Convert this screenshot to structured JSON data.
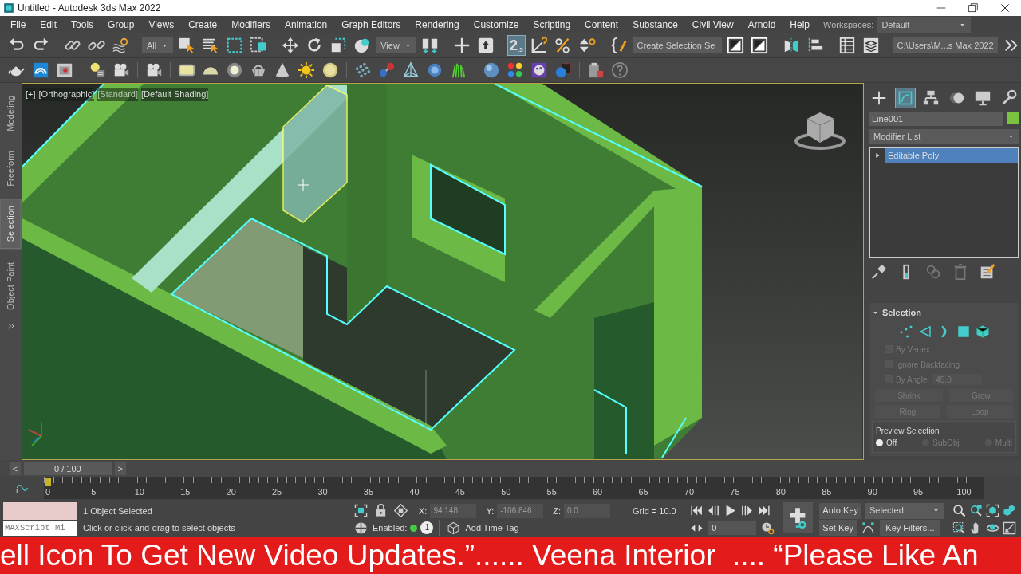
{
  "window": {
    "title": "Untitled - Autodesk 3ds Max 2022"
  },
  "menu": [
    "File",
    "Edit",
    "Tools",
    "Group",
    "Views",
    "Create",
    "Modifiers",
    "Animation",
    "Graph Editors",
    "Rendering",
    "Customize",
    "Scripting",
    "Content",
    "Substance",
    "Civil View",
    "Arnold",
    "Help"
  ],
  "workspaces": {
    "label": "Workspaces:",
    "value": "Default"
  },
  "toolbar": {
    "selection_filter": "All",
    "reference_coordinate": "View",
    "snap_toggle": {
      "label": "2",
      "sub": ".5",
      "selected": true
    },
    "named_selection": "Create Selection Se",
    "project_path": "C:\\Users\\M...s Max 2022"
  },
  "ribbon_tabs": [
    {
      "label": "Modeling",
      "selected": false
    },
    {
      "label": "Freeform",
      "selected": false
    },
    {
      "label": "Selection",
      "selected": true
    },
    {
      "label": "Object Paint",
      "selected": false
    }
  ],
  "viewport": {
    "labels": [
      {
        "text": "[+]",
        "kind": "menu"
      },
      {
        "text": "[Orthographic]",
        "kind": "menu"
      },
      {
        "text": "[Standard]",
        "kind": "dim"
      },
      {
        "text": "[Default Shading]",
        "kind": "menu"
      }
    ]
  },
  "command_panel": {
    "tabs": [
      {
        "selected": false
      },
      {
        "selected": true
      },
      {
        "selected": false
      },
      {
        "selected": false
      },
      {
        "selected": false
      },
      {
        "selected": false
      }
    ],
    "object_name": "Line001",
    "modifier_list": "Modifier List",
    "stack": [
      {
        "label": "Editable Poly",
        "selected": true
      }
    ],
    "selection": {
      "title": "Selection",
      "levels": [
        {
          "selected": false
        },
        {
          "selected": false
        },
        {
          "selected": false
        },
        {
          "selected": false
        },
        {
          "selected": false
        }
      ],
      "checks": [
        {
          "label": "By Vertex",
          "checked": false,
          "disabled": true
        },
        {
          "label": "Ignore Backfacing",
          "checked": false,
          "disabled": true
        }
      ],
      "angle": {
        "label": "By Angle:",
        "value": "45.0",
        "checked": false,
        "disabled": true
      },
      "buttons": [
        {
          "label": "Shrink",
          "disabled": true
        },
        {
          "label": "Grow",
          "disabled": true
        },
        {
          "label": "Ring",
          "disabled": true
        },
        {
          "label": "Loop",
          "disabled": true
        }
      ],
      "preview": {
        "title": "Preview Selection",
        "options": [
          {
            "label": "Off",
            "selected": true,
            "disabled": false
          },
          {
            "label": "SubObj",
            "selected": false,
            "disabled": true
          },
          {
            "label": "Multi",
            "selected": false,
            "disabled": true
          }
        ]
      }
    }
  },
  "timeline": {
    "level": 0,
    "prev": "<",
    "position": "0 / 100",
    "next": ">",
    "ticks": [
      "0",
      "5",
      "10",
      "15",
      "20",
      "25",
      "30",
      "35",
      "40",
      "45",
      "50",
      "55",
      "60",
      "65",
      "70",
      "75",
      "80",
      "85",
      "90",
      "95",
      "100"
    ]
  },
  "status": {
    "selected": "1 Object Selected",
    "prompt": "Click or click-and-drag to select objects",
    "maxscript": "MAXScript Mi",
    "x": {
      "label": "X:",
      "value": "94.148"
    },
    "y": {
      "label": "Y:",
      "value": "-106.846"
    },
    "z": {
      "label": "Z:",
      "value": "0.0"
    },
    "grid": "Grid = 10.0",
    "enabled": {
      "label": "Enabled:",
      "on": true
    },
    "isolate": "1",
    "time_tag": "Add Time Tag",
    "frame": "0",
    "auto_key": "Auto Key",
    "key_mode": "Selected",
    "set_key": "Set Key",
    "key_filters": "Key Filters..."
  },
  "banner": "ell Icon To Get New Video Updates.”...... Veena Interior  .... “Please Like An"
}
